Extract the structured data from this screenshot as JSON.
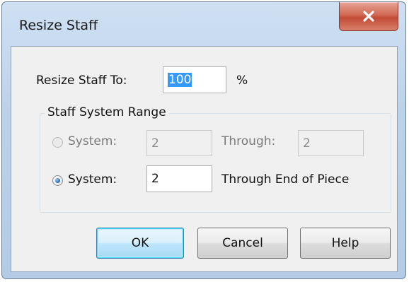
{
  "window": {
    "title": "Resize Staff",
    "close_icon": "close-x-icon"
  },
  "resize": {
    "label": "Resize Staff To:",
    "value": "100",
    "unit": "%"
  },
  "range": {
    "caption": "Staff System Range",
    "option1": {
      "label": "System:",
      "system_value": "2",
      "through_label": "Through:",
      "through_value": "2",
      "selected": false,
      "enabled": false
    },
    "option2": {
      "label": "System:",
      "system_value": "2",
      "through_label": "Through End of Piece",
      "selected": true,
      "enabled": true
    }
  },
  "buttons": {
    "ok": "OK",
    "cancel": "Cancel",
    "help": "Help"
  },
  "colors": {
    "close_button": "#c24b36",
    "default_button_border": "#3c7fb1",
    "selection": "#3399ff"
  }
}
